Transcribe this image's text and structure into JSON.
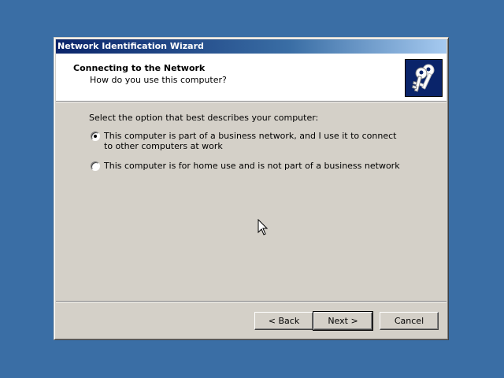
{
  "window": {
    "title": "Network Identification Wizard"
  },
  "header": {
    "title": "Connecting to the Network",
    "subtitle": "How do you use this computer?",
    "image_icon": "keys-icon"
  },
  "content": {
    "prompt": "Select the option that best describes your computer:",
    "options": [
      {
        "label": "This computer is part of a business network, and I use it to connect to other computers at work",
        "selected": true
      },
      {
        "label": "This computer is for home use and is not part of a business network",
        "selected": false
      }
    ]
  },
  "buttons": {
    "back": "< Back",
    "next": "Next >",
    "cancel": "Cancel"
  },
  "colors": {
    "desktop": "#3a6ea5",
    "titlebar_start": "#0a246a",
    "titlebar_end": "#a6caf0",
    "face": "#d4d0c8"
  }
}
